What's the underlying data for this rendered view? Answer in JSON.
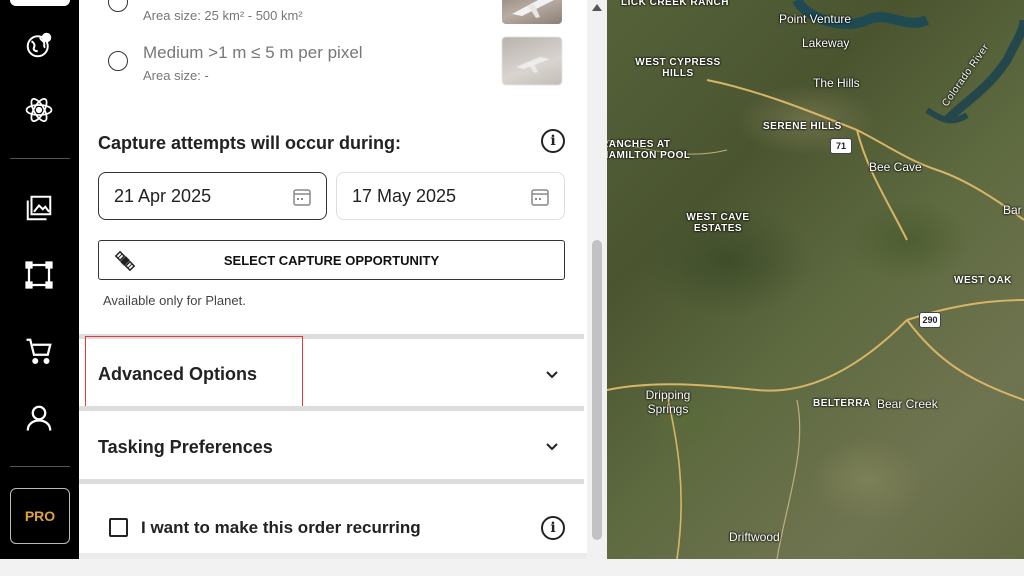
{
  "sidebar": {
    "items": [
      {
        "icon": "globe-icon"
      },
      {
        "icon": "atom-icon"
      },
      {
        "icon": "gallery-icon"
      },
      {
        "icon": "aoi-shape-icon"
      },
      {
        "icon": "cart-icon"
      },
      {
        "icon": "user-icon"
      }
    ],
    "pro_label": "PRO"
  },
  "resolution_options": [
    {
      "title": "",
      "subtitle": "Area size: 25 km² - 500 km²",
      "selected": false
    },
    {
      "title": "Medium >1 m ≤ 5 m per pixel",
      "subtitle": "Area size: -",
      "selected": false
    }
  ],
  "capture": {
    "heading": "Capture attempts will occur during:",
    "start_date": "21 Apr 2025",
    "end_date": "17 May 2025",
    "select_button": "SELECT CAPTURE OPPORTUNITY",
    "note": "Available only for Planet."
  },
  "sections": {
    "advanced": "Advanced Options",
    "tasking": "Tasking Preferences"
  },
  "recurring": {
    "label": "I want to make this order recurring",
    "checked": false
  },
  "map": {
    "labels": [
      {
        "text": "LICK CREEK RANCH"
      },
      {
        "text": "Point Venture"
      },
      {
        "text": "Lakeway"
      },
      {
        "text": "WEST CYPRESS HILLS"
      },
      {
        "text": "The Hills"
      },
      {
        "text": "Colorado River"
      },
      {
        "text": "SERENE HILLS"
      },
      {
        "text": "RANCHES AT HAMILTON POOL"
      },
      {
        "text": "Bee Cave"
      },
      {
        "text": "WEST CAVE ESTATES"
      },
      {
        "text": "Bar"
      },
      {
        "text": "WEST OAK"
      },
      {
        "text": "Dripping Springs"
      },
      {
        "text": "BELTERRA"
      },
      {
        "text": "Bear Creek"
      },
      {
        "text": "Driftwood"
      }
    ],
    "shields": [
      "71",
      "290"
    ]
  },
  "colors": {
    "accent_pro": "#e2a33a",
    "highlight": "#e53935"
  }
}
